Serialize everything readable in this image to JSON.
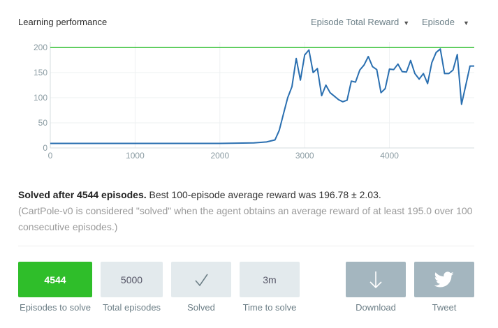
{
  "header": {
    "title": "Learning performance",
    "metric_select": "Episode Total Reward",
    "axis_select": "Episode"
  },
  "chart_data": {
    "type": "line",
    "title": "",
    "xlabel": "",
    "ylabel": "",
    "xlim": [
      0,
      5000
    ],
    "ylim": [
      0,
      200
    ],
    "x_ticks": [
      0,
      1000,
      2000,
      3000,
      4000
    ],
    "y_ticks": [
      0,
      50,
      100,
      150,
      200
    ],
    "grid": true,
    "threshold": 195,
    "series": [
      {
        "color": "#2a6fb0",
        "x": [
          0,
          500,
          1000,
          1500,
          2000,
          2400,
          2550,
          2650,
          2700,
          2750,
          2800,
          2850,
          2900,
          2950,
          3000,
          3050,
          3100,
          3150,
          3200,
          3250,
          3300,
          3350,
          3400,
          3450,
          3500,
          3550,
          3600,
          3650,
          3700,
          3750,
          3800,
          3850,
          3900,
          3950,
          4000,
          4050,
          4100,
          4150,
          4200,
          4250,
          4300,
          4350,
          4400,
          4450,
          4500,
          4550,
          4600,
          4650,
          4700,
          4750,
          4800,
          4850,
          4900,
          4950,
          5000
        ],
        "y": [
          9,
          9,
          9,
          9,
          9,
          10,
          12,
          16,
          35,
          68,
          100,
          122,
          178,
          135,
          185,
          195,
          150,
          158,
          104,
          125,
          110,
          103,
          96,
          92,
          95,
          133,
          131,
          155,
          165,
          182,
          162,
          156,
          110,
          118,
          157,
          156,
          167,
          152,
          151,
          174,
          148,
          137,
          148,
          128,
          170,
          190,
          197,
          148,
          148,
          155,
          186,
          87,
          125,
          163,
          163
        ]
      }
    ]
  },
  "summary": {
    "headline": "Solved after 4544 episodes.",
    "best": "Best 100-episode average reward was 196.78 ± 2.03.",
    "note": "(CartPole-v0 is considered \"solved\" when the agent obtains an average reward of at least 195.0 over 100 consecutive episodes.)"
  },
  "stats": {
    "episodes_to_solve": {
      "value": "4544",
      "label": "Episodes to solve"
    },
    "total_episodes": {
      "value": "5000",
      "label": "Total episodes"
    },
    "solved": {
      "label": "Solved",
      "icon": "check-icon"
    },
    "time_to_solve": {
      "value": "3m",
      "label": "Time to solve"
    },
    "download": {
      "label": "Download",
      "icon": "download-arrow-icon"
    },
    "tweet": {
      "label": "Tweet",
      "icon": "twitter-bird-icon"
    }
  },
  "colors": {
    "accent_green": "#2fbe2a",
    "threshold_line": "#2dbe2d",
    "series_line": "#2a6fb0",
    "tile_bg": "#e3eaed",
    "action_bg": "#a4b6bf"
  }
}
